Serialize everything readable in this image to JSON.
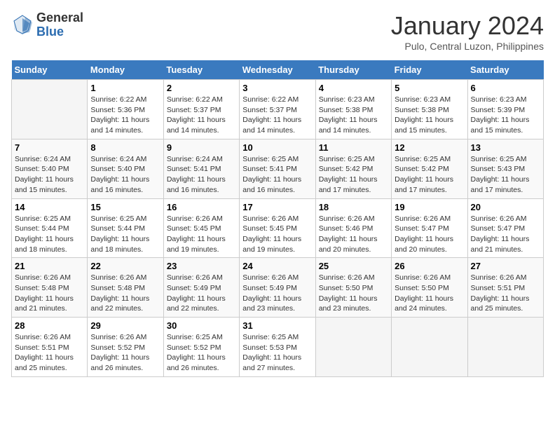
{
  "header": {
    "logo_general": "General",
    "logo_blue": "Blue",
    "month_year": "January 2024",
    "location": "Pulo, Central Luzon, Philippines"
  },
  "weekdays": [
    "Sunday",
    "Monday",
    "Tuesday",
    "Wednesday",
    "Thursday",
    "Friday",
    "Saturday"
  ],
  "weeks": [
    [
      {
        "day": "",
        "sunrise": "",
        "sunset": "",
        "daylight": ""
      },
      {
        "day": "1",
        "sunrise": "Sunrise: 6:22 AM",
        "sunset": "Sunset: 5:36 PM",
        "daylight": "Daylight: 11 hours and 14 minutes."
      },
      {
        "day": "2",
        "sunrise": "Sunrise: 6:22 AM",
        "sunset": "Sunset: 5:37 PM",
        "daylight": "Daylight: 11 hours and 14 minutes."
      },
      {
        "day": "3",
        "sunrise": "Sunrise: 6:22 AM",
        "sunset": "Sunset: 5:37 PM",
        "daylight": "Daylight: 11 hours and 14 minutes."
      },
      {
        "day": "4",
        "sunrise": "Sunrise: 6:23 AM",
        "sunset": "Sunset: 5:38 PM",
        "daylight": "Daylight: 11 hours and 14 minutes."
      },
      {
        "day": "5",
        "sunrise": "Sunrise: 6:23 AM",
        "sunset": "Sunset: 5:38 PM",
        "daylight": "Daylight: 11 hours and 15 minutes."
      },
      {
        "day": "6",
        "sunrise": "Sunrise: 6:23 AM",
        "sunset": "Sunset: 5:39 PM",
        "daylight": "Daylight: 11 hours and 15 minutes."
      }
    ],
    [
      {
        "day": "7",
        "sunrise": "Sunrise: 6:24 AM",
        "sunset": "Sunset: 5:40 PM",
        "daylight": "Daylight: 11 hours and 15 minutes."
      },
      {
        "day": "8",
        "sunrise": "Sunrise: 6:24 AM",
        "sunset": "Sunset: 5:40 PM",
        "daylight": "Daylight: 11 hours and 16 minutes."
      },
      {
        "day": "9",
        "sunrise": "Sunrise: 6:24 AM",
        "sunset": "Sunset: 5:41 PM",
        "daylight": "Daylight: 11 hours and 16 minutes."
      },
      {
        "day": "10",
        "sunrise": "Sunrise: 6:25 AM",
        "sunset": "Sunset: 5:41 PM",
        "daylight": "Daylight: 11 hours and 16 minutes."
      },
      {
        "day": "11",
        "sunrise": "Sunrise: 6:25 AM",
        "sunset": "Sunset: 5:42 PM",
        "daylight": "Daylight: 11 hours and 17 minutes."
      },
      {
        "day": "12",
        "sunrise": "Sunrise: 6:25 AM",
        "sunset": "Sunset: 5:42 PM",
        "daylight": "Daylight: 11 hours and 17 minutes."
      },
      {
        "day": "13",
        "sunrise": "Sunrise: 6:25 AM",
        "sunset": "Sunset: 5:43 PM",
        "daylight": "Daylight: 11 hours and 17 minutes."
      }
    ],
    [
      {
        "day": "14",
        "sunrise": "Sunrise: 6:25 AM",
        "sunset": "Sunset: 5:44 PM",
        "daylight": "Daylight: 11 hours and 18 minutes."
      },
      {
        "day": "15",
        "sunrise": "Sunrise: 6:25 AM",
        "sunset": "Sunset: 5:44 PM",
        "daylight": "Daylight: 11 hours and 18 minutes."
      },
      {
        "day": "16",
        "sunrise": "Sunrise: 6:26 AM",
        "sunset": "Sunset: 5:45 PM",
        "daylight": "Daylight: 11 hours and 19 minutes."
      },
      {
        "day": "17",
        "sunrise": "Sunrise: 6:26 AM",
        "sunset": "Sunset: 5:45 PM",
        "daylight": "Daylight: 11 hours and 19 minutes."
      },
      {
        "day": "18",
        "sunrise": "Sunrise: 6:26 AM",
        "sunset": "Sunset: 5:46 PM",
        "daylight": "Daylight: 11 hours and 20 minutes."
      },
      {
        "day": "19",
        "sunrise": "Sunrise: 6:26 AM",
        "sunset": "Sunset: 5:47 PM",
        "daylight": "Daylight: 11 hours and 20 minutes."
      },
      {
        "day": "20",
        "sunrise": "Sunrise: 6:26 AM",
        "sunset": "Sunset: 5:47 PM",
        "daylight": "Daylight: 11 hours and 21 minutes."
      }
    ],
    [
      {
        "day": "21",
        "sunrise": "Sunrise: 6:26 AM",
        "sunset": "Sunset: 5:48 PM",
        "daylight": "Daylight: 11 hours and 21 minutes."
      },
      {
        "day": "22",
        "sunrise": "Sunrise: 6:26 AM",
        "sunset": "Sunset: 5:48 PM",
        "daylight": "Daylight: 11 hours and 22 minutes."
      },
      {
        "day": "23",
        "sunrise": "Sunrise: 6:26 AM",
        "sunset": "Sunset: 5:49 PM",
        "daylight": "Daylight: 11 hours and 22 minutes."
      },
      {
        "day": "24",
        "sunrise": "Sunrise: 6:26 AM",
        "sunset": "Sunset: 5:49 PM",
        "daylight": "Daylight: 11 hours and 23 minutes."
      },
      {
        "day": "25",
        "sunrise": "Sunrise: 6:26 AM",
        "sunset": "Sunset: 5:50 PM",
        "daylight": "Daylight: 11 hours and 23 minutes."
      },
      {
        "day": "26",
        "sunrise": "Sunrise: 6:26 AM",
        "sunset": "Sunset: 5:50 PM",
        "daylight": "Daylight: 11 hours and 24 minutes."
      },
      {
        "day": "27",
        "sunrise": "Sunrise: 6:26 AM",
        "sunset": "Sunset: 5:51 PM",
        "daylight": "Daylight: 11 hours and 25 minutes."
      }
    ],
    [
      {
        "day": "28",
        "sunrise": "Sunrise: 6:26 AM",
        "sunset": "Sunset: 5:51 PM",
        "daylight": "Daylight: 11 hours and 25 minutes."
      },
      {
        "day": "29",
        "sunrise": "Sunrise: 6:26 AM",
        "sunset": "Sunset: 5:52 PM",
        "daylight": "Daylight: 11 hours and 26 minutes."
      },
      {
        "day": "30",
        "sunrise": "Sunrise: 6:25 AM",
        "sunset": "Sunset: 5:52 PM",
        "daylight": "Daylight: 11 hours and 26 minutes."
      },
      {
        "day": "31",
        "sunrise": "Sunrise: 6:25 AM",
        "sunset": "Sunset: 5:53 PM",
        "daylight": "Daylight: 11 hours and 27 minutes."
      },
      {
        "day": "",
        "sunrise": "",
        "sunset": "",
        "daylight": ""
      },
      {
        "day": "",
        "sunrise": "",
        "sunset": "",
        "daylight": ""
      },
      {
        "day": "",
        "sunrise": "",
        "sunset": "",
        "daylight": ""
      }
    ]
  ]
}
